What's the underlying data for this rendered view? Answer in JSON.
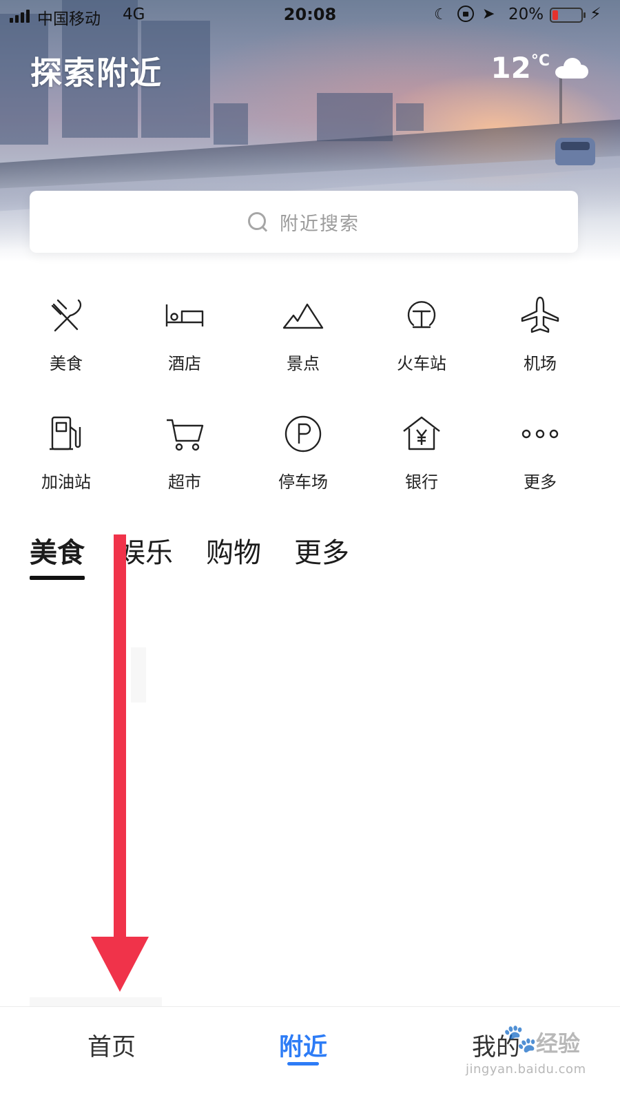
{
  "status_bar": {
    "carrier": "中国移动",
    "network": "4G",
    "time": "20:08",
    "battery_percent": "20%",
    "battery_level": 0.2
  },
  "header": {
    "title": "探索附近",
    "weather": {
      "temperature": "12",
      "unit": "°C",
      "icon": "cloud-icon"
    }
  },
  "search": {
    "placeholder": "附近搜索"
  },
  "categories": [
    {
      "label": "美食",
      "icon": "utensils-icon"
    },
    {
      "label": "酒店",
      "icon": "bed-icon"
    },
    {
      "label": "景点",
      "icon": "mountain-icon"
    },
    {
      "label": "火车站",
      "icon": "train-station-icon"
    },
    {
      "label": "机场",
      "icon": "airplane-icon"
    },
    {
      "label": "加油站",
      "icon": "fuel-pump-icon"
    },
    {
      "label": "超市",
      "icon": "shopping-cart-icon"
    },
    {
      "label": "停车场",
      "icon": "parking-icon"
    },
    {
      "label": "银行",
      "icon": "bank-icon"
    },
    {
      "label": "更多",
      "icon": "more-dots-icon"
    }
  ],
  "tabs": [
    {
      "label": "美食",
      "active": true
    },
    {
      "label": "娱乐",
      "active": false
    },
    {
      "label": "购物",
      "active": false
    },
    {
      "label": "更多",
      "active": false
    }
  ],
  "bottom_nav": [
    {
      "label": "首页",
      "active": false
    },
    {
      "label": "附近",
      "active": true
    },
    {
      "label": "我的",
      "active": false
    }
  ],
  "colors": {
    "accent": "#2d7cf6",
    "annotation_arrow": "#f0334a"
  },
  "watermark": {
    "text": "经验",
    "url": "jingyan.baidu.com"
  }
}
